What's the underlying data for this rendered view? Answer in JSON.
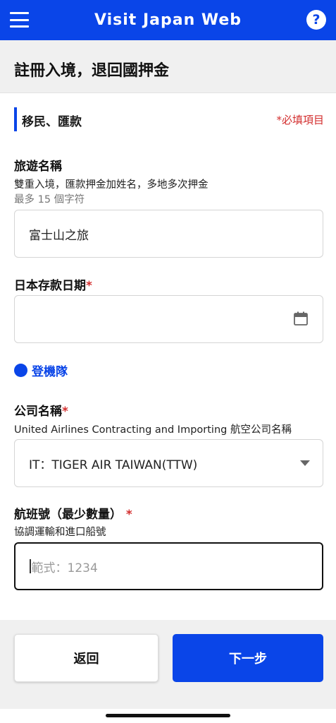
{
  "app": {
    "title": "Visit Japan Web"
  },
  "icons": {
    "menu": "hamburger-menu-icon",
    "help": "question-circle-icon",
    "calendar": "calendar-icon",
    "dropdown": "chevron-down-icon"
  },
  "colors": {
    "brand": "#0a45e8",
    "required": "#d32f2f"
  },
  "header": {
    "help_glyph": "?",
    "page_title": "註冊入境，退回國押金"
  },
  "section": {
    "title": "移民、匯款",
    "required_note": "*必填項目"
  },
  "fields": {
    "trip_name": {
      "label": "旅遊名稱",
      "description": "雙重入境，匯款押金加姓名，多地多次押金",
      "hint": "最多 15 個字符",
      "value": "富士山之旅"
    },
    "deposit_date": {
      "label": "日本存款日期",
      "required_mark": "*",
      "value": ""
    },
    "boarding_link": "登機隊",
    "company_name": {
      "label": "公司名稱",
      "required_mark": "*",
      "description": "United Airlines Contracting and Importing 航空公司名稱",
      "selected": "IT：TIGER AIR TAIWAN(TTW)"
    },
    "flight_number": {
      "label": "航班號（最少數量）",
      "required_mark": "*",
      "description": "協調運輸和進口船號",
      "placeholder": "範式：1234",
      "value": ""
    }
  },
  "footer": {
    "back_label": "返回",
    "next_label": "下一步"
  }
}
